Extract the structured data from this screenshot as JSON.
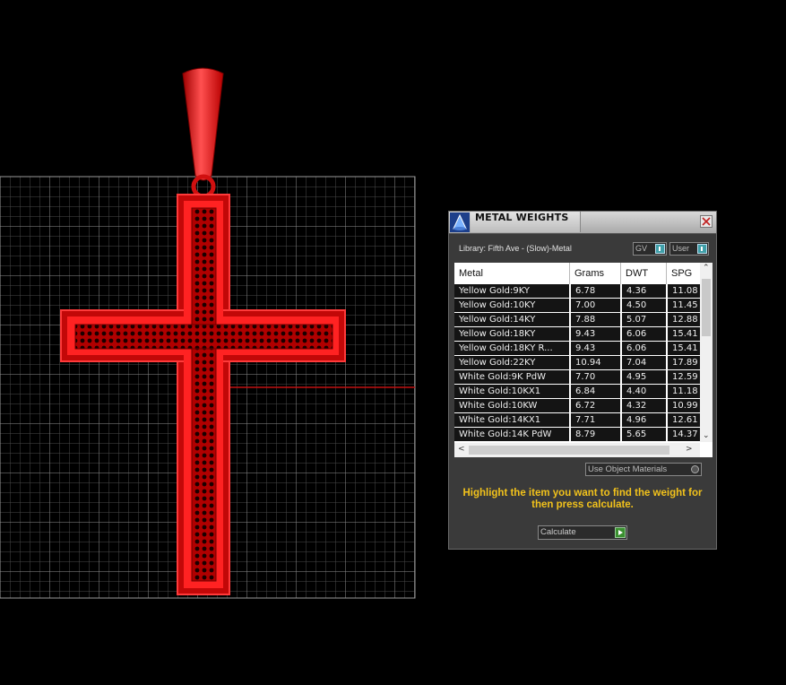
{
  "panel": {
    "title": "METAL WEIGHTS",
    "library_label": "Library: Fifth Ave - (Slow)-Metal",
    "toggle_gv": "GV",
    "toggle_user": "User",
    "columns": [
      "Metal",
      "Grams",
      "DWT",
      "SPG"
    ],
    "rows": [
      [
        "Yellow Gold:9KY",
        "6.78",
        "4.36",
        "11.08"
      ],
      [
        "Yellow Gold:10KY",
        "7.00",
        "4.50",
        "11.45"
      ],
      [
        "Yellow Gold:14KY",
        "7.88",
        "5.07",
        "12.88"
      ],
      [
        "Yellow Gold:18KY",
        "9.43",
        "6.06",
        "15.41"
      ],
      [
        "Yellow Gold:18KY R...",
        "9.43",
        "6.06",
        "15.41"
      ],
      [
        "Yellow Gold:22KY",
        "10.94",
        "7.04",
        "17.89"
      ],
      [
        "White Gold:9K PdW",
        "7.70",
        "4.95",
        "12.59"
      ],
      [
        "White Gold:10KX1",
        "6.84",
        "4.40",
        "11.18"
      ],
      [
        "White Gold:10KW",
        "6.72",
        "4.32",
        "10.99"
      ],
      [
        "White Gold:14KX1",
        "7.71",
        "4.96",
        "12.61"
      ],
      [
        "White Gold:14K PdW",
        "8.79",
        "5.65",
        "14.37"
      ]
    ],
    "use_object_materials": "Use Object Materials",
    "hint": "Highlight the item you want to find the weight for then press calculate.",
    "calculate_label": "Calculate"
  },
  "colors": {
    "cross": "#e01010",
    "grid": "#8a8a8a",
    "hint_text": "#f2c21b",
    "background": "#000000"
  },
  "icons": {
    "app": "blue-cone-icon",
    "close": "close-icon",
    "calculate": "play-arrow-icon"
  }
}
